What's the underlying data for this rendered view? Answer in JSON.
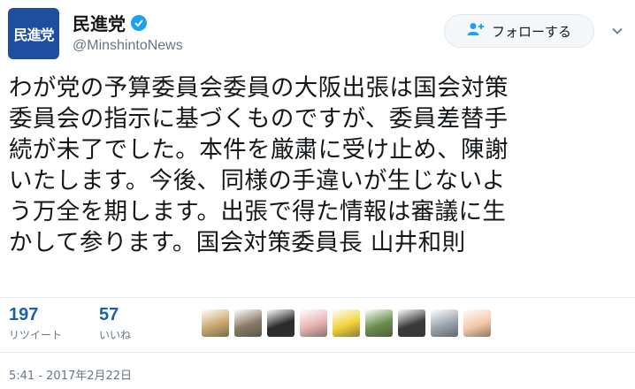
{
  "account": {
    "logo_text": "民進党",
    "display_name": "民進党",
    "handle": "@MinshintoNews",
    "verified": true
  },
  "follow_button": {
    "label": "フォローする",
    "icon": "user-add-icon"
  },
  "tweet": {
    "lines": [
      "わが党の予算委員会委員の大阪出張は国会対策",
      "委員会の指示に基づくものですが、委員差替手",
      "続が未了でした。本件を厳粛に受け止め、陳謝",
      "いたします。今後、同様の手違いが生じないよ",
      "う万全を期します。出張で得た情報は審議に生",
      "かして参ります。国会対策委員長 山井和則"
    ]
  },
  "stats": {
    "retweets": {
      "count": "197",
      "label": "リツイート"
    },
    "likes": {
      "count": "57",
      "label": "いいね"
    }
  },
  "avatars": [
    {
      "name": "avatar-1",
      "color": "#c9a96e"
    },
    {
      "name": "avatar-2",
      "color": "#8a7a66"
    },
    {
      "name": "avatar-3",
      "color": "#2b2b2b"
    },
    {
      "name": "avatar-4",
      "color": "#e8b3b3"
    },
    {
      "name": "avatar-5",
      "color": "#f2d23a"
    },
    {
      "name": "avatar-6",
      "color": "#6b8e4e"
    },
    {
      "name": "avatar-7",
      "color": "#3a3a3a"
    },
    {
      "name": "avatar-8",
      "color": "#9aa4ad"
    },
    {
      "name": "avatar-9",
      "color": "#f4c9a8"
    }
  ],
  "timestamp": "5:41 - 2017年2月22日",
  "colors": {
    "accent": "#1da1f2",
    "count": "#1b5fa6",
    "logo_bg": "#1f4ea1"
  }
}
